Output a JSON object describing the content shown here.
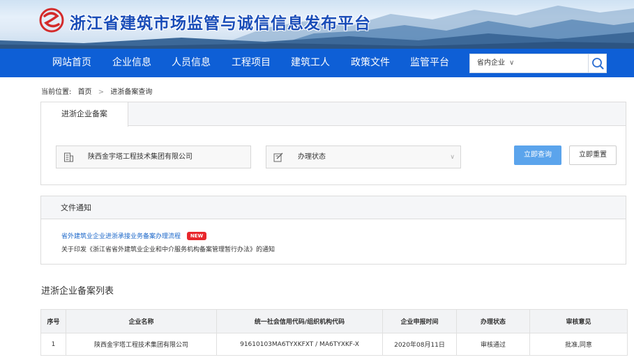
{
  "header": {
    "site_title": "浙江省建筑市场监管与诚信信息发布平台"
  },
  "nav": {
    "items": [
      {
        "label": "网站首页"
      },
      {
        "label": "企业信息"
      },
      {
        "label": "人员信息"
      },
      {
        "label": "工程项目"
      },
      {
        "label": "建筑工人"
      },
      {
        "label": "政策文件"
      },
      {
        "label": "监管平台"
      }
    ],
    "search": {
      "select_value": "省内企业",
      "placeholder": ""
    }
  },
  "breadcrumb": {
    "prefix": "当前位置:",
    "home": "首页",
    "separator": ">",
    "current": "进浙备案查询"
  },
  "search_panel": {
    "tab_label": "进浙企业备案",
    "company_value": "陕西金宇塔工程技术集团有限公司",
    "status_placeholder": "办理状态",
    "query_button": "立即查询",
    "reset_button": "立即重置"
  },
  "notice": {
    "title": "文件通知",
    "link_text": "省外建筑业企业进浙承接业务备案办理流程",
    "badge": "NEW",
    "text": "关于印发《浙江省省外建筑业企业和中介服务机构备案管理暂行办法》的通知"
  },
  "list": {
    "title": "进浙企业备案列表",
    "columns": [
      "序号",
      "企业名称",
      "统一社会信用代码/组织机构代码",
      "企业申报时间",
      "办理状态",
      "审核意见"
    ],
    "rows": [
      [
        "1",
        "陕西金宇塔工程技术集团有限公司",
        "91610103MA6TYXKFXT / MA6TYXKF-X",
        "2020年08月11日",
        "审核通过",
        "批准,同意"
      ]
    ]
  },
  "colors": {
    "nav_bg": "#0e5fd6",
    "title_blue": "#1a4db8",
    "query_button": "#5ba4ec",
    "badge_red": "#e8272c",
    "link_blue": "#1a66c9"
  }
}
